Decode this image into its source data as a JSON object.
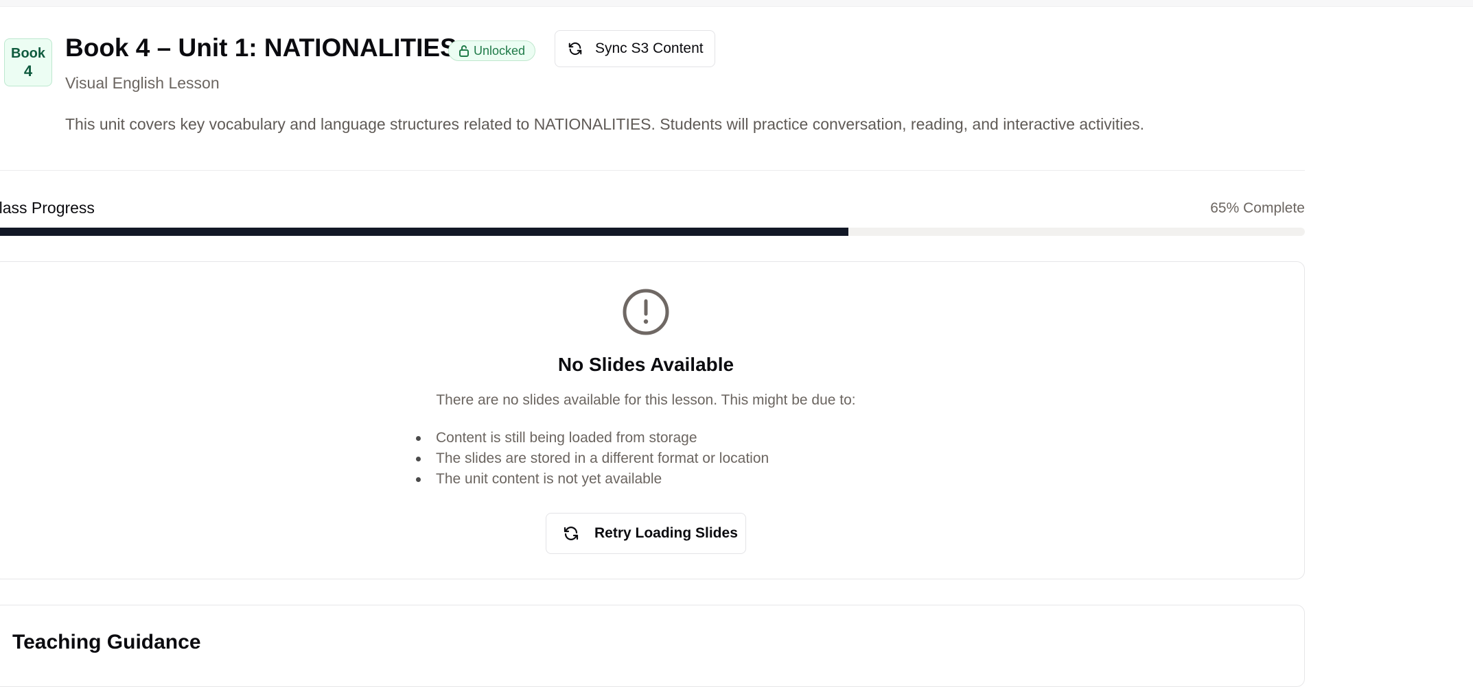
{
  "header": {
    "book_badge": {
      "label": "Book",
      "number": "4"
    },
    "title": "Book 4 – Unit 1: NATIONALITIES",
    "status_badge": "Unlocked",
    "sync_button": "Sync S3 Content",
    "subtitle": "Visual English Lesson",
    "description": "This unit covers key vocabulary and language structures related to NATIONALITIES. Students will practice conversation, reading, and interactive activities."
  },
  "progress": {
    "label": "Class Progress",
    "value_text": "65% Complete",
    "fraction": 0.65
  },
  "empty_state": {
    "title": "No Slides Available",
    "text": "There are no slides available for this lesson. This might be due to:",
    "reasons": [
      "Content is still being loaded from storage",
      "The slides are stored in a different format or location",
      "The unit content is not yet available"
    ],
    "retry_button": "Retry Loading Slides"
  },
  "guidance": {
    "title": "Teaching Guidance"
  },
  "icons": {
    "lock": "unlock-icon",
    "sync": "refresh-icon",
    "alert": "alert-circle-icon",
    "retry": "refresh-icon"
  },
  "colors": {
    "accent_dark": "#121826",
    "badge_green_bg": "#ecfdf3",
    "badge_green_text": "#1f7a48",
    "muted_text": "#6b6560"
  }
}
